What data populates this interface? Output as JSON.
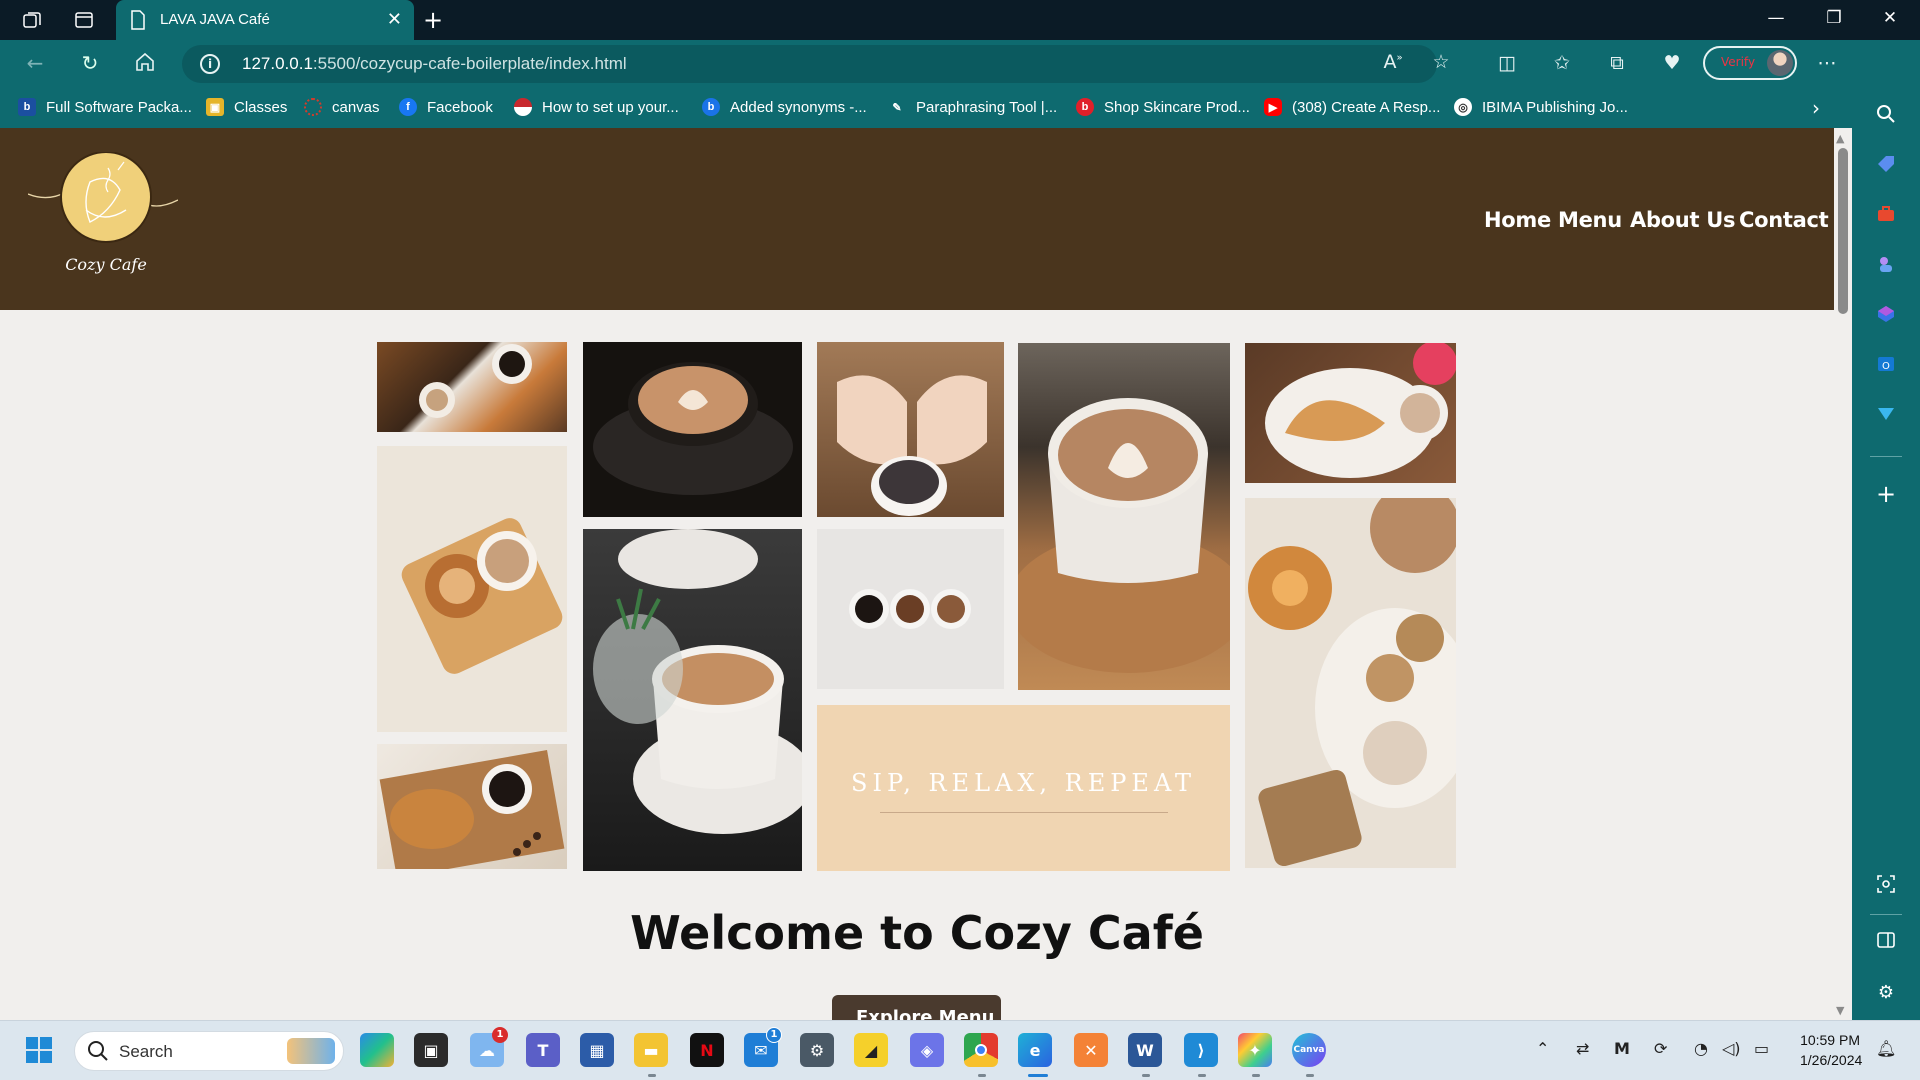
{
  "browser": {
    "tab_title": "LAVA JAVA Café",
    "url_host": "127.0.0.1",
    "url_path": ":5500/cozycup-cafe-boilerplate/index.html",
    "profile_label": "Verify",
    "accent": "#0e6a6f"
  },
  "favorites": [
    {
      "label": "Full Software Packa...",
      "icon": "brother-icon",
      "color": "#1b4fa0"
    },
    {
      "label": "Classes",
      "icon": "classroom-icon",
      "color": "#e5b52a"
    },
    {
      "label": "canvas",
      "icon": "canvas-icon",
      "color": "#d43b2b"
    },
    {
      "label": "Facebook",
      "icon": "facebook-icon",
      "color": "#1877f2"
    },
    {
      "label": "How to set up your...",
      "icon": "pokeball-icon",
      "color": "#c8282d"
    },
    {
      "label": "Added synonyms -...",
      "icon": "bird-icon",
      "color": "#1a73e8"
    },
    {
      "label": "Paraphrasing Tool |...",
      "icon": "pen-icon",
      "color": "#ffffff"
    },
    {
      "label": "Shop Skincare Prod...",
      "icon": "drop-icon",
      "color": "#e0202a"
    },
    {
      "label": "(308) Create A Resp...",
      "icon": "youtube-icon",
      "color": "#ff0000"
    },
    {
      "label": "IBIMA Publishing Jo...",
      "icon": "globe-icon",
      "color": "#ffffff"
    }
  ],
  "site": {
    "logo_text": "Cozy Cafe",
    "nav": [
      "Home",
      "Menu",
      "About Us",
      "Contact"
    ],
    "tagline": "SIP, RELAX, REPEAT",
    "welcome": "Welcome to Cozy Café",
    "cta": "Explore Menu",
    "header_color": "#4a351d"
  },
  "taskbar": {
    "search_placeholder": "Search",
    "time": "10:59 PM",
    "date": "1/26/2024"
  }
}
